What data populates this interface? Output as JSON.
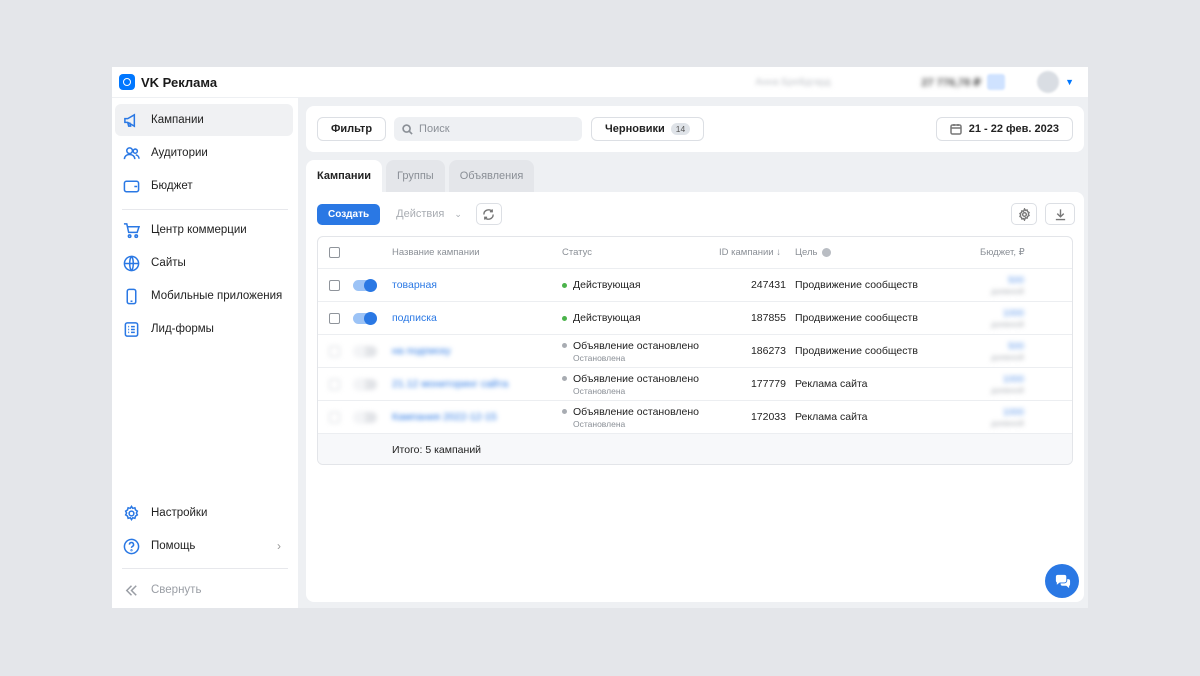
{
  "brand": {
    "name": "VK Реклама"
  },
  "topbar": {
    "account": "Анна Брейдгард",
    "balance": "27 776,78 ₽"
  },
  "sidebar": {
    "items": [
      {
        "label": "Кампании",
        "icon": "megaphone-icon",
        "active": true
      },
      {
        "label": "Аудитории",
        "icon": "users-icon"
      },
      {
        "label": "Бюджет",
        "icon": "wallet-icon"
      },
      {
        "label": "Центр коммерции",
        "icon": "cart-icon"
      },
      {
        "label": "Сайты",
        "icon": "globe-icon"
      },
      {
        "label": "Мобильные приложения",
        "icon": "phone-icon"
      },
      {
        "label": "Лид-формы",
        "icon": "form-icon"
      }
    ],
    "bottom": [
      {
        "label": "Настройки",
        "icon": "gear-icon"
      },
      {
        "label": "Помощь",
        "icon": "help-icon"
      }
    ],
    "collapse": "Свернуть"
  },
  "filterbar": {
    "filter": "Фильтр",
    "search_placeholder": "Поиск",
    "drafts": "Черновики",
    "drafts_count": "14",
    "date_range": "21 - 22 фев. 2023"
  },
  "tabs": [
    "Кампании",
    "Группы",
    "Объявления"
  ],
  "actions": {
    "create": "Создать",
    "actions": "Действия"
  },
  "table": {
    "columns": {
      "name": "Название кампании",
      "status": "Статус",
      "id": "ID кампании ↓",
      "goal": "Цель",
      "budget": "Бюджет, ₽"
    },
    "rows": [
      {
        "name": "товарная",
        "status": "Действующая",
        "substatus": "",
        "id": "247431",
        "goal": "Продвижение сообществ",
        "budget": "500",
        "budget_sub": "дневной",
        "enabled": true,
        "blurred": false
      },
      {
        "name": "подписка",
        "status": "Действующая",
        "substatus": "",
        "id": "187855",
        "goal": "Продвижение сообществ",
        "budget": "1000",
        "budget_sub": "дневной",
        "enabled": true,
        "blurred": false
      },
      {
        "name": "на подписку",
        "status": "Объявление остановлено",
        "substatus": "Остановлена",
        "id": "186273",
        "goal": "Продвижение сообществ",
        "budget": "500",
        "budget_sub": "дневной",
        "enabled": false,
        "blurred": true
      },
      {
        "name": "21.12 мониторинг сайта",
        "status": "Объявление остановлено",
        "substatus": "Остановлена",
        "id": "177779",
        "goal": "Реклама сайта",
        "budget": "1000",
        "budget_sub": "дневной",
        "enabled": false,
        "blurred": true
      },
      {
        "name": "Кампания 2022-12-15",
        "status": "Объявление остановлено",
        "substatus": "Остановлена",
        "id": "172033",
        "goal": "Реклама сайта",
        "budget": "1000",
        "budget_sub": "дневной",
        "enabled": false,
        "blurred": true
      }
    ],
    "total": "Итого: 5 кампаний"
  },
  "colors": {
    "accent": "#2a78e4",
    "active_status": "#4bb34b",
    "inactive_status": "#a8acb2"
  }
}
